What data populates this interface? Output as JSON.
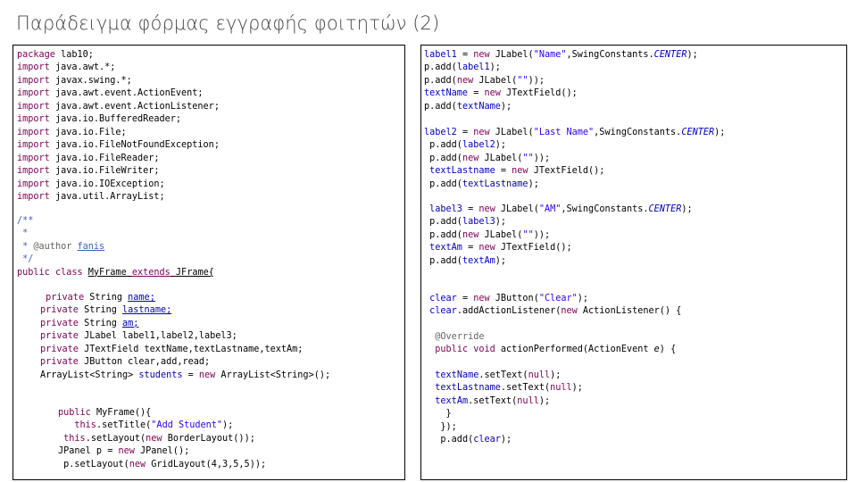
{
  "slide": {
    "title": "Παράδειγμα φόρμας εγγραφής φοιτητών (2)"
  },
  "left_code": {
    "pkg_kw": "package",
    "pkg_name": " lab10;",
    "imports_kw": [
      "import",
      "import",
      "import",
      "import",
      "import",
      "import",
      "import",
      "import",
      "import",
      "import",
      "import",
      "import"
    ],
    "imports": [
      " java.awt.*;",
      " javax.swing.*;",
      " java.awt.event.ActionEvent;",
      " java.awt.event.ActionListener;",
      " java.io.BufferedReader;",
      " java.io.File;",
      " java.io.FileNotFoundException;",
      " java.io.FileReader;",
      " java.io.FileWriter;",
      " java.io.IOException;",
      " java.util.ArrayList;"
    ],
    "doc_open": "/**",
    "doc_star": " *",
    "doc_author_prefix": " * ",
    "doc_author_tag": "@author",
    "doc_author_name": "fanis",
    "doc_close": " */",
    "class_public": "public",
    "class_kw": "class",
    "class_name": "MyFrame",
    "class_extends": "extends",
    "class_parent": "JFrame{",
    "private_kw": "private",
    "f1_type": " String ",
    "f1_name": "name;",
    "f2_type": " String ",
    "f2_name": "lastname;",
    "f3_type": " String ",
    "f3_name": "am;",
    "f4_rest": " JLabel label1,label2,label3;",
    "f5_rest": " JTextField textName,textLastname,textAm;",
    "f6_rest": " JButton clear,add,read;",
    "list_type": "ArrayList<String> ",
    "list_name": "students",
    "list_eq": " = ",
    "new_kw": "new",
    "list_ctor": " ArrayList<String>();",
    "ctor_public": "public",
    "ctor_sig": " MyFrame(){",
    "this_kw": "this",
    "set_title": ".setTitle(",
    "title_str": "\"Add Student\"",
    "close_paren": ");",
    "set_layout": ".setLayout(",
    "border_layout": " BorderLayout());",
    "panel_decl": "JPanel p = ",
    "panel_ctor": " JPanel();",
    "grid_prefix": "p.setLayout(",
    "grid_ctor": " GridLayout(4,3,5,5));"
  },
  "right_code": {
    "label1": "label1",
    "label2": "label2",
    "label3": "label3",
    "assign": " = ",
    "new_kw": "new",
    "jlabel_open": " JLabel(",
    "str_name": "\"Name\"",
    "str_lastname": "\"Last Name\"",
    "str_am": "\"AM\"",
    "str_empty": "\"\"",
    "swing_center": ",SwingConstants.",
    "center": "CENTER",
    "close": ");",
    "close2": "));",
    "p_add_open": "p.add(",
    "p_add_new_open": "p.add(",
    "textName": "textName",
    "textLastname": "textLastname",
    "textAm": "textAm",
    "jtextfield": " JTextField();",
    "clear": "clear",
    "jbutton_open": " JButton(",
    "str_clear": "\"Clear\"",
    "add_listener": ".addActionListener(",
    "action_listener": " ActionListener() {",
    "override": "@Override",
    "public_kw": "public",
    "void_kw": "void",
    "action_performed": " actionPerformed(ActionEvent ",
    "param_e": "e",
    "brace_open": ") {",
    "set_text": ".setText(",
    "null_kw": "null",
    "brace_close": "}",
    "paren_close": "});"
  }
}
